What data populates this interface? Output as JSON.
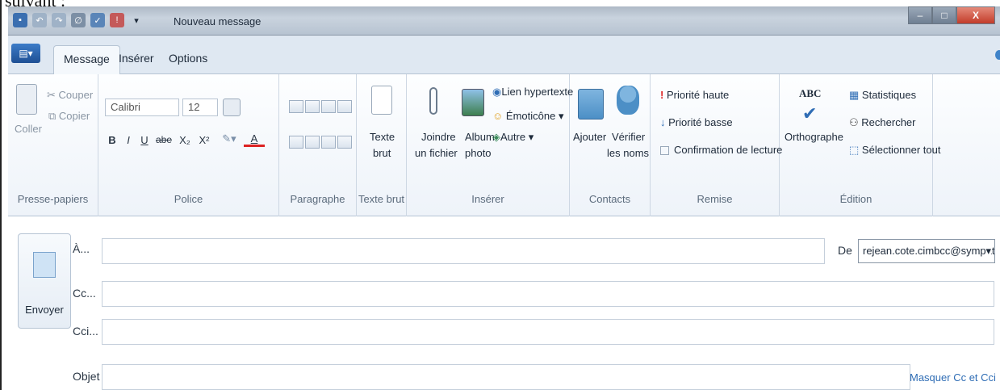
{
  "doc": {
    "cropped_text": "suivant :"
  },
  "window": {
    "title": "Nouveau message",
    "qat_icons": [
      "save-icon",
      "undo-icon",
      "redo-icon",
      "attach-icon",
      "spellcheck-icon",
      "priority-icon",
      "dropdown-icon"
    ],
    "buttons": {
      "minimize": "–",
      "maximize": "□",
      "close": "X"
    }
  },
  "tabs": [
    {
      "label": "Message",
      "active": true
    },
    {
      "label": "Insérer",
      "active": false
    },
    {
      "label": "Options",
      "active": false
    }
  ],
  "ribbon": {
    "clipboard": {
      "label": "Presse-papiers",
      "paste": "Coller",
      "cut": "Couper",
      "copy": "Copier"
    },
    "font": {
      "label": "Police",
      "font_name": "Calibri",
      "font_size": "12",
      "bold": "B",
      "italic": "I",
      "underline": "U",
      "strike": "abe",
      "sub": "X₂",
      "sup": "X²",
      "color": "A"
    },
    "paragraph": {
      "label": "Paragraphe"
    },
    "plaintext": {
      "label": "Texte brut",
      "button_line1": "Texte",
      "button_line2": "brut"
    },
    "insert": {
      "label": "Insérer",
      "attach_line1": "Joindre",
      "attach_line2": "un fichier",
      "album_line1": "Album",
      "album_line2": "photo",
      "hyperlink": "Lien hypertexte",
      "emoticon": "Émoticône",
      "other": "Autre"
    },
    "contacts": {
      "label": "Contacts",
      "add": "Ajouter",
      "check_line1": "Vérifier",
      "check_line2": "les noms"
    },
    "delivery": {
      "label": "Remise",
      "high": "Priorité haute",
      "low": "Priorité basse",
      "receipt": "Confirmation de lecture"
    },
    "editing": {
      "label": "Édition",
      "spelling": "Orthographe",
      "spelling_icon_text": "ABC",
      "stats": "Statistiques",
      "find": "Rechercher",
      "select_all": "Sélectionner tout"
    }
  },
  "compose": {
    "send": "Envoyer",
    "to_label": "À...",
    "cc_label": "Cc...",
    "bcc_label": "Cci...",
    "subject_label": "Objet",
    "to_value": "",
    "cc_value": "",
    "bcc_value": "",
    "subject_value": "",
    "from_label": "De",
    "from_value": "rejean.cote.cimbcc@sympatic",
    "hide_cc_link": "Masquer Cc et Cci"
  }
}
